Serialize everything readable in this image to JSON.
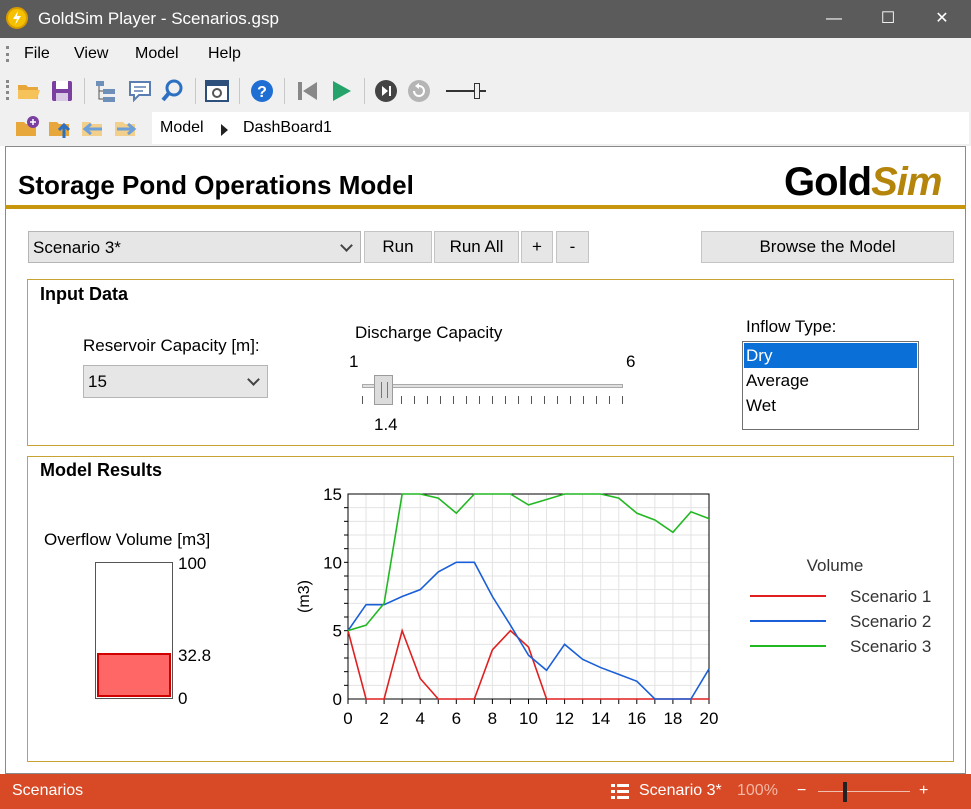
{
  "window": {
    "title": "GoldSim Player - Scenarios.gsp",
    "minimize": "—",
    "maximize": "☐",
    "close": "✕"
  },
  "menu": {
    "file": "File",
    "view": "View",
    "model": "Model",
    "help": "Help"
  },
  "toolbar": {
    "icons": [
      "open-folder-icon",
      "save-icon",
      "tree-view-icon",
      "comment-icon",
      "search-icon",
      "dashboard-icon",
      "help-icon",
      "go-to-start-icon",
      "play-icon",
      "step-icon",
      "reset-icon",
      "speed-slider"
    ]
  },
  "breadcrumb": {
    "items": [
      "Model",
      "DashBoard1"
    ]
  },
  "dashboard": {
    "title": "Storage Pond Operations Model",
    "logo_a": "Gold",
    "logo_b": "Sim",
    "scenario_select": "Scenario 3*",
    "run_label": "Run",
    "run_all_label": "Run All",
    "add_label": "+",
    "remove_label": "-",
    "browse_label": "Browse the Model"
  },
  "input": {
    "title": "Input Data",
    "reservoir_label": "Reservoir Capacity [m]:",
    "reservoir_value": "15",
    "discharge_label": "Discharge Capacity",
    "discharge_min": "1",
    "discharge_max": "6",
    "discharge_value": "1.4",
    "discharge_value_num": 1.4,
    "inflow_label": "Inflow Type:",
    "inflow_options": [
      "Dry",
      "Average",
      "Wet"
    ],
    "inflow_selected": "Dry"
  },
  "results": {
    "title": "Model Results",
    "overflow_label": "Overflow Volume [m3]",
    "gauge_max": "100",
    "gauge_value": "32.8",
    "gauge_min": "0",
    "gauge_fraction": 0.328
  },
  "chart_data": {
    "type": "line",
    "title": "",
    "xlabel": "",
    "ylabel": "(m3)",
    "xlim": [
      0,
      20
    ],
    "ylim": [
      0,
      15
    ],
    "x_ticks": [
      "0",
      "2",
      "4",
      "6",
      "8",
      "10",
      "12",
      "14",
      "16",
      "18",
      "20"
    ],
    "y_ticks": [
      "0",
      "5",
      "10",
      "15"
    ],
    "grid": true,
    "legend_title": "Volume",
    "legend_position": "right",
    "x": [
      0,
      1,
      2,
      3,
      4,
      5,
      6,
      7,
      8,
      9,
      10,
      11,
      12,
      13,
      14,
      15,
      16,
      17,
      18,
      19,
      20
    ],
    "series": [
      {
        "name": "Scenario 1",
        "color": "#e02020",
        "values": [
          5,
          0,
          0,
          5,
          1.5,
          0,
          0,
          0,
          3.6,
          5,
          3.8,
          0,
          0,
          0,
          0,
          0,
          0,
          0,
          0,
          0,
          0
        ]
      },
      {
        "name": "Scenario 2",
        "color": "#1a5fd8",
        "values": [
          5,
          6.9,
          6.9,
          7.5,
          8,
          9.3,
          10,
          10,
          7.5,
          5.4,
          3.2,
          2.1,
          4,
          2.9,
          2.3,
          1.8,
          1.3,
          0,
          0,
          0,
          2.2
        ]
      },
      {
        "name": "Scenario 3",
        "color": "#22b822",
        "values": [
          5,
          5.4,
          7,
          15,
          15,
          14.7,
          13.6,
          15,
          15,
          15,
          14.2,
          14.6,
          15,
          15,
          15,
          14.7,
          13.6,
          13.1,
          12.2,
          13.7,
          13.2
        ]
      }
    ]
  },
  "status": {
    "left": "Scenarios",
    "scenario": "Scenario 3*",
    "zoom": "100%",
    "zoom_out": "−",
    "zoom_in": "+"
  }
}
